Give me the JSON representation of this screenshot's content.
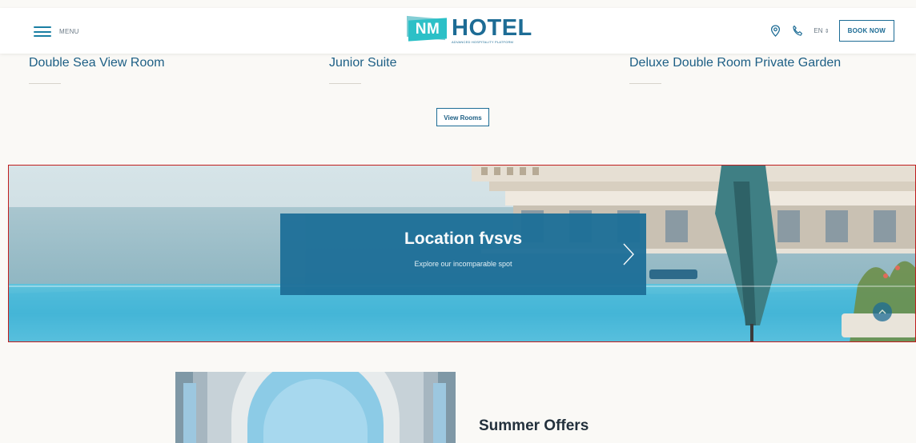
{
  "header": {
    "menu_label": "MENU",
    "logo_mark": "NM",
    "logo_word": "HOTEL",
    "logo_tagline": "ADVANCED HOSPITALITY PLATFORM",
    "language": "EN",
    "book_label": "BOOK NOW",
    "icons": [
      "location-icon",
      "phone-icon"
    ]
  },
  "rooms": {
    "items": [
      {
        "name": "Double Sea View Room"
      },
      {
        "name": "Junior Suite"
      },
      {
        "name": "Deluxe Double Room Private Garden"
      }
    ],
    "view_label": "View Rooms"
  },
  "location": {
    "title": "Location fvsvs",
    "subtitle": "Explore our incomparable spot"
  },
  "offers": {
    "title": "Summer Offers"
  },
  "colors": {
    "brand": "#1d6c95",
    "accent": "#2cc0c7",
    "overlay": "#1d6f98",
    "page_bg": "#faf9f6"
  }
}
